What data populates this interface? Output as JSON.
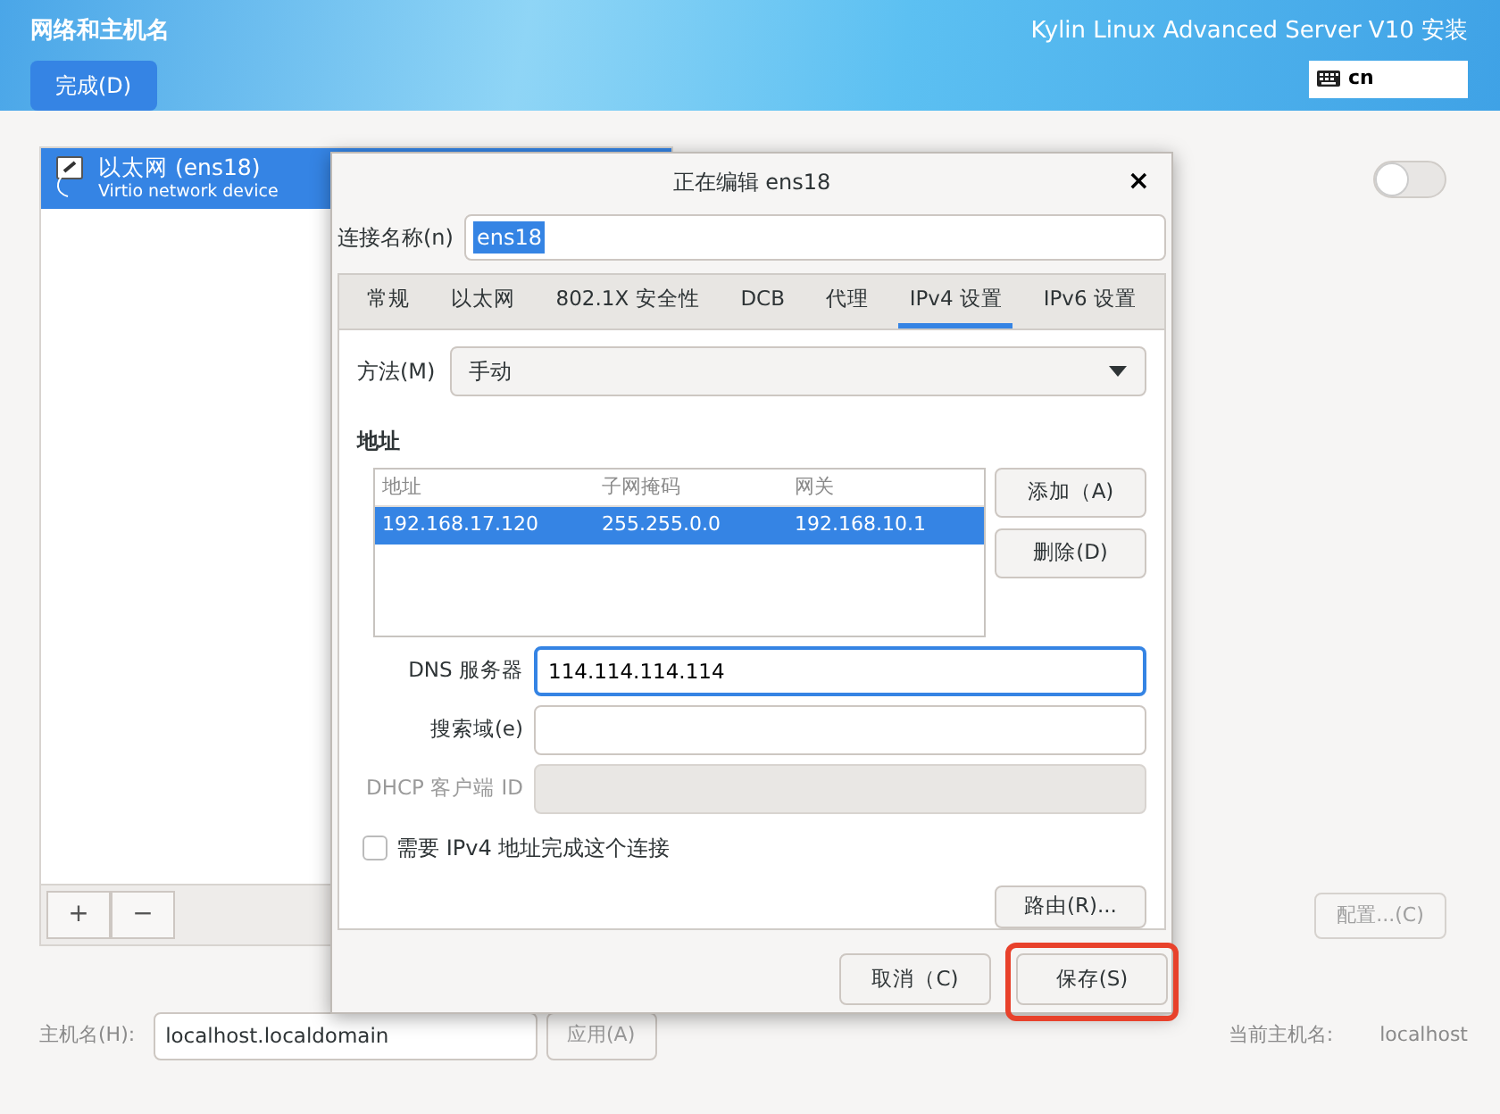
{
  "header": {
    "title": "网络和主机名",
    "done_button": "完成(D)",
    "product": "Kylin Linux Advanced Server V10 安装",
    "keyboard_layout": "cn"
  },
  "devices": [
    {
      "name": "以太网 (ens18)",
      "description": "Virtio network device",
      "selected": true
    }
  ],
  "device_buttons": [
    "+",
    "−"
  ],
  "device_switch": {
    "on": false
  },
  "configure_button": {
    "label": "配置...(C)",
    "disabled": true
  },
  "hostname": {
    "label": "主机名(H):",
    "value": "localhost.localdomain",
    "apply": "应用(A)",
    "current_label": "当前主机名:",
    "current_value": "localhost"
  },
  "dialog": {
    "title": "正在编辑 ens18",
    "close": "×",
    "connection_name": {
      "label": "连接名称(n)",
      "value": "ens18",
      "text_selected": true
    },
    "tabs": [
      {
        "label": "常规",
        "selected": false
      },
      {
        "label": "以太网",
        "selected": false
      },
      {
        "label": "802.1X 安全性",
        "selected": false
      },
      {
        "label": "DCB",
        "selected": false
      },
      {
        "label": "代理",
        "selected": false
      },
      {
        "label": "IPv4 设置",
        "selected": true
      },
      {
        "label": "IPv6 设置",
        "selected": false
      }
    ],
    "method": {
      "label": "方法(M)",
      "value": "手动"
    },
    "address_heading": "地址",
    "table": {
      "columns": [
        "地址",
        "子网掩码",
        "网关"
      ],
      "rows": [
        {
          "cells": [
            "192.168.17.120",
            "255.255.0.0",
            "192.168.10.1"
          ],
          "selected": true
        }
      ]
    },
    "table_buttons": [
      "添加（A)",
      "删除(D)"
    ],
    "fields": [
      {
        "label": "DNS 服务器",
        "value": "114.114.114.114",
        "focused": true,
        "disabled": false
      },
      {
        "label": "搜索域(e)",
        "focused": false,
        "disabled": false
      },
      {
        "label": "DHCP 客户端 ID",
        "focused": false,
        "disabled": true
      }
    ],
    "require_ipv4": {
      "label": "需要 IPv4 地址完成这个连接",
      "checked": false
    },
    "routes_button": "路由(R)...",
    "footer_buttons": [
      {
        "label": "取消（C)",
        "highlighted": false
      },
      {
        "label": "保存(S)",
        "highlighted": true
      }
    ]
  }
}
